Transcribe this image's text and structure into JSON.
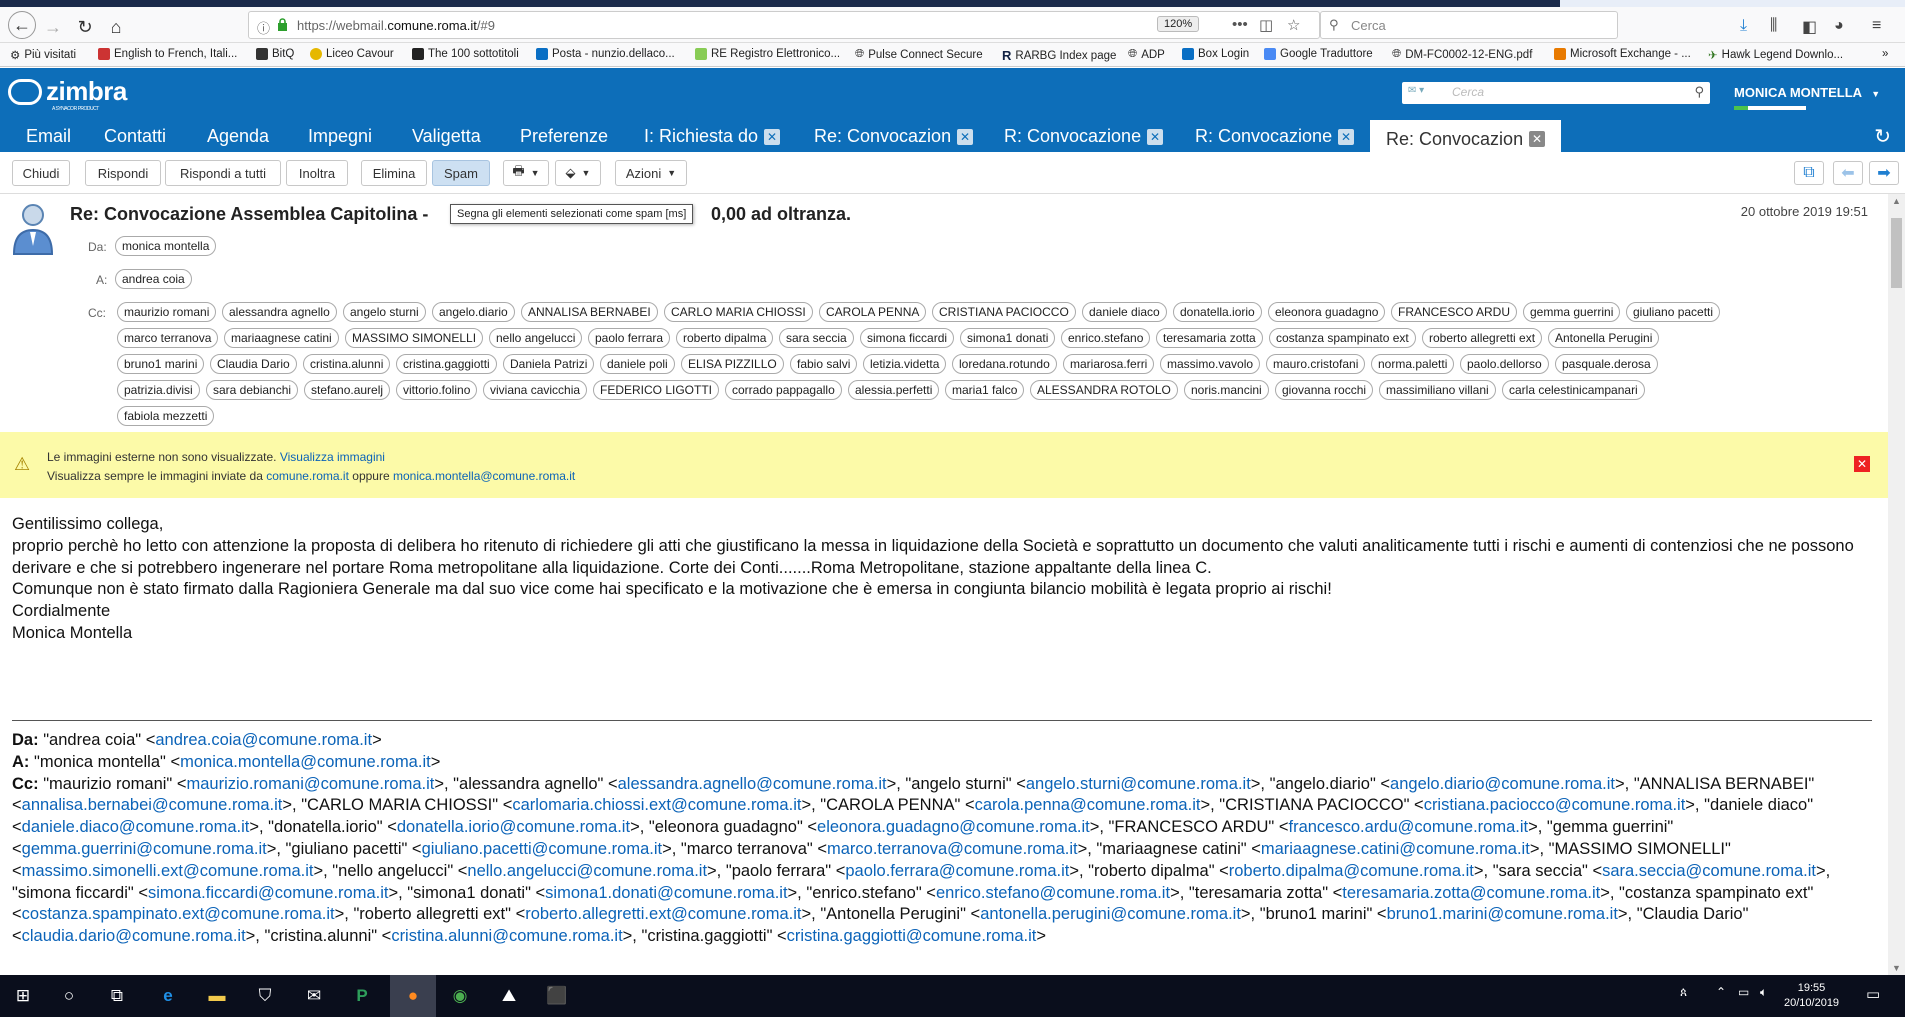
{
  "browser": {
    "url_prefix": "https://webmail.",
    "url_domain": "comune.roma.it",
    "url_suffix": "/#9",
    "zoom": "120%",
    "search_placeholder": "Cerca",
    "bookmarks": [
      "Più visitati",
      "English to French, Itali...",
      "BitQ",
      "Liceo Cavour",
      "The 100 sottotitoli",
      "Posta - nunzio.dellaco...",
      "RE Registro Elettronico...",
      "Pulse Connect Secure",
      "RARBG Index page",
      "ADP",
      "Box Login",
      "Google Traduttore",
      "DM-FC0002-12-ENG.pdf",
      "Microsoft Exchange - ...",
      "Hawk Legend Downlo..."
    ]
  },
  "zimbra": {
    "logo": "zimbra",
    "logo_sub": "A SYNACOR PRODUCT",
    "search_placeholder": "Cerca",
    "user": "MONICA MONTELLA",
    "apps": [
      "Email",
      "Contatti",
      "Agenda",
      "Impegni",
      "Valigetta",
      "Preferenze"
    ],
    "tabs": [
      "I: Richiesta do",
      "Re: Convocazion",
      "R: Convocazione",
      "R: Convocazione",
      "Re: Convocazion"
    ]
  },
  "toolbar": {
    "close": "Chiudi",
    "reply": "Rispondi",
    "reply_all": "Rispondi a tutti",
    "forward": "Inoltra",
    "delete": "Elimina",
    "spam": "Spam",
    "actions": "Azioni"
  },
  "message": {
    "subject_start": "Re: Convocazione Assemblea Capitolina -",
    "subject_end": "0,00 ad oltranza.",
    "tooltip": "Segna gli elementi selezionati come spam [ms]",
    "date": "20 ottobre 2019 19:51",
    "from_label": "Da:",
    "to_label": "A:",
    "cc_label": "Cc:",
    "from": "monica montella",
    "to": "andrea coia",
    "cc_rows": [
      [
        "maurizio romani",
        "alessandra agnello",
        "angelo sturni",
        "angelo.diario",
        "ANNALISA BERNABEI",
        "CARLO MARIA CHIOSSI",
        "CAROLA PENNA",
        "CRISTIANA PACIOCCO",
        "daniele diaco",
        "donatella.iorio",
        "eleonora guadagno",
        "FRANCESCO ARDU",
        "gemma guerrini",
        "giuliano pacetti"
      ],
      [
        "marco terranova",
        "mariaagnese catini",
        "MASSIMO SIMONELLI",
        "nello angelucci",
        "paolo ferrara",
        "roberto dipalma",
        "sara seccia",
        "simona ficcardi",
        "simona1 donati",
        "enrico.stefano",
        "teresamaria zotta",
        "costanza spampinato ext",
        "roberto allegretti ext",
        "Antonella Perugini"
      ],
      [
        "bruno1 marini",
        "Claudia Dario",
        "cristina.alunni",
        "cristina.gaggiotti",
        "Daniela Patrizi",
        "daniele poli",
        "ELISA PIZZILLO",
        "fabio salvi",
        "letizia.videtta",
        "loredana.rotundo",
        "mariarosa.ferri",
        "massimo.vavolo",
        "mauro.cristofani",
        "norma.paletti",
        "paolo.dellorso",
        "pasquale.derosa"
      ],
      [
        "patrizia.divisi",
        "sara debianchi",
        "stefano.aurelj",
        "vittorio.folino",
        "viviana cavicchia",
        "FEDERICO LIGOTTI",
        "corrado pappagallo",
        "alessia.perfetti",
        "maria1 falco",
        "ALESSANDRA ROTOLO",
        "noris.mancini",
        "giovanna rocchi",
        "massimiliano villani",
        "carla celestinicampanari"
      ],
      [
        "fabiola mezzetti"
      ]
    ]
  },
  "images_bar": {
    "line1": "Le immagini esterne non sono visualizzate.",
    "line1_link": "Visualizza immagini",
    "line2": "Visualizza sempre le immagini inviate da",
    "domain_link": "comune.roma.it",
    "or": "oppure",
    "email_link": "monica.montella@comune.roma.it"
  },
  "body": [
    "Gentilissimo collega,",
    "proprio perchè ho letto con attenzione la proposta di delibera ho ritenuto di richiedere gli atti che giustificano la messa in liquidazione della Società e soprattutto un documento che valuti analiticamente tutti i rischi e aumenti di contenziosi che ne possono derivare e che si potrebbero ingenerare nel portare Roma metropolitane alla liquidazione. Corte dei Conti.......Roma Metropolitane, stazione appaltante  della linea C.",
    "Comunque non è stato firmato dalla Ragioniera Generale ma dal suo vice come hai specificato e la motivazione che è emersa in congiunta bilancio mobilità  è legata proprio ai rischi!",
    "Cordialmente",
    "Monica Montella"
  ],
  "quoted": {
    "from_label": "Da:",
    "from": "\"andrea coia\" <",
    "from_email": "andrea.coia@comune.roma.it",
    "from_end": ">",
    "to_label": "A:",
    "to": "\"monica montella\" <",
    "to_email": "monica.montella@comune.roma.it",
    "to_end": ">",
    "cc_label": "Cc:",
    "cc": [
      [
        "maurizio romani",
        "maurizio.romani@comune.roma.it"
      ],
      [
        "alessandra agnello",
        "alessandra.agnello@comune.roma.it"
      ],
      [
        "angelo sturni",
        "angelo.sturni@comune.roma.it"
      ],
      [
        "angelo.diario",
        "angelo.diario@comune.roma.it"
      ],
      [
        "ANNALISA BERNABEI",
        "annalisa.bernabei@comune.roma.it"
      ],
      [
        "CARLO MARIA CHIOSSI",
        "carlomaria.chiossi.ext@comune.roma.it"
      ],
      [
        "CAROLA PENNA",
        "carola.penna@comune.roma.it"
      ],
      [
        "CRISTIANA PACIOCCO",
        "cristiana.paciocco@comune.roma.it"
      ],
      [
        "daniele diaco",
        "daniele.diaco@comune.roma.it"
      ],
      [
        "donatella.iorio",
        "donatella.iorio@comune.roma.it"
      ],
      [
        "eleonora guadagno",
        "eleonora.guadagno@comune.roma.it"
      ],
      [
        "FRANCESCO ARDU",
        "francesco.ardu@comune.roma.it"
      ],
      [
        "gemma guerrini",
        "gemma.guerrini@comune.roma.it"
      ],
      [
        "giuliano pacetti",
        "giuliano.pacetti@comune.roma.it"
      ],
      [
        "marco terranova",
        "marco.terranova@comune.roma.it"
      ],
      [
        "mariaagnese catini",
        "mariaagnese.catini@comune.roma.it"
      ],
      [
        "MASSIMO SIMONELLI",
        "massimo.simonelli.ext@comune.roma.it"
      ],
      [
        "nello angelucci",
        "nello.angelucci@comune.roma.it"
      ],
      [
        "paolo ferrara",
        "paolo.ferrara@comune.roma.it"
      ],
      [
        "roberto dipalma",
        "roberto.dipalma@comune.roma.it"
      ],
      [
        "sara seccia",
        "sara.seccia@comune.roma.it"
      ],
      [
        "simona ficcardi",
        "simona.ficcardi@comune.roma.it"
      ],
      [
        "simona1 donati",
        "simona1.donati@comune.roma.it"
      ],
      [
        "enrico.stefano",
        "enrico.stefano@comune.roma.it"
      ],
      [
        "teresamaria zotta",
        "teresamaria.zotta@comune.roma.it"
      ],
      [
        "costanza spampinato ext",
        "costanza.spampinato.ext@comune.roma.it"
      ],
      [
        "roberto allegretti ext",
        "roberto.allegretti.ext@comune.roma.it"
      ],
      [
        "Antonella Perugini",
        "antonella.perugini@comune.roma.it"
      ],
      [
        "bruno1 marini",
        "bruno1.marini@comune.roma.it"
      ],
      [
        "Claudia Dario",
        "claudia.dario@comune.roma.it"
      ],
      [
        "cristina.alunni",
        "cristina.alunni@comune.roma.it"
      ],
      [
        "cristina.gaggiotti",
        "cristina.gaggiotti@comune.roma.it"
      ]
    ]
  },
  "taskbar": {
    "time": "19:55",
    "date": "20/10/2019"
  },
  "colors": {
    "zimbra_blue": "#0d6eb9",
    "link": "#0b63b8",
    "warning_bg": "#fcfaa8"
  }
}
